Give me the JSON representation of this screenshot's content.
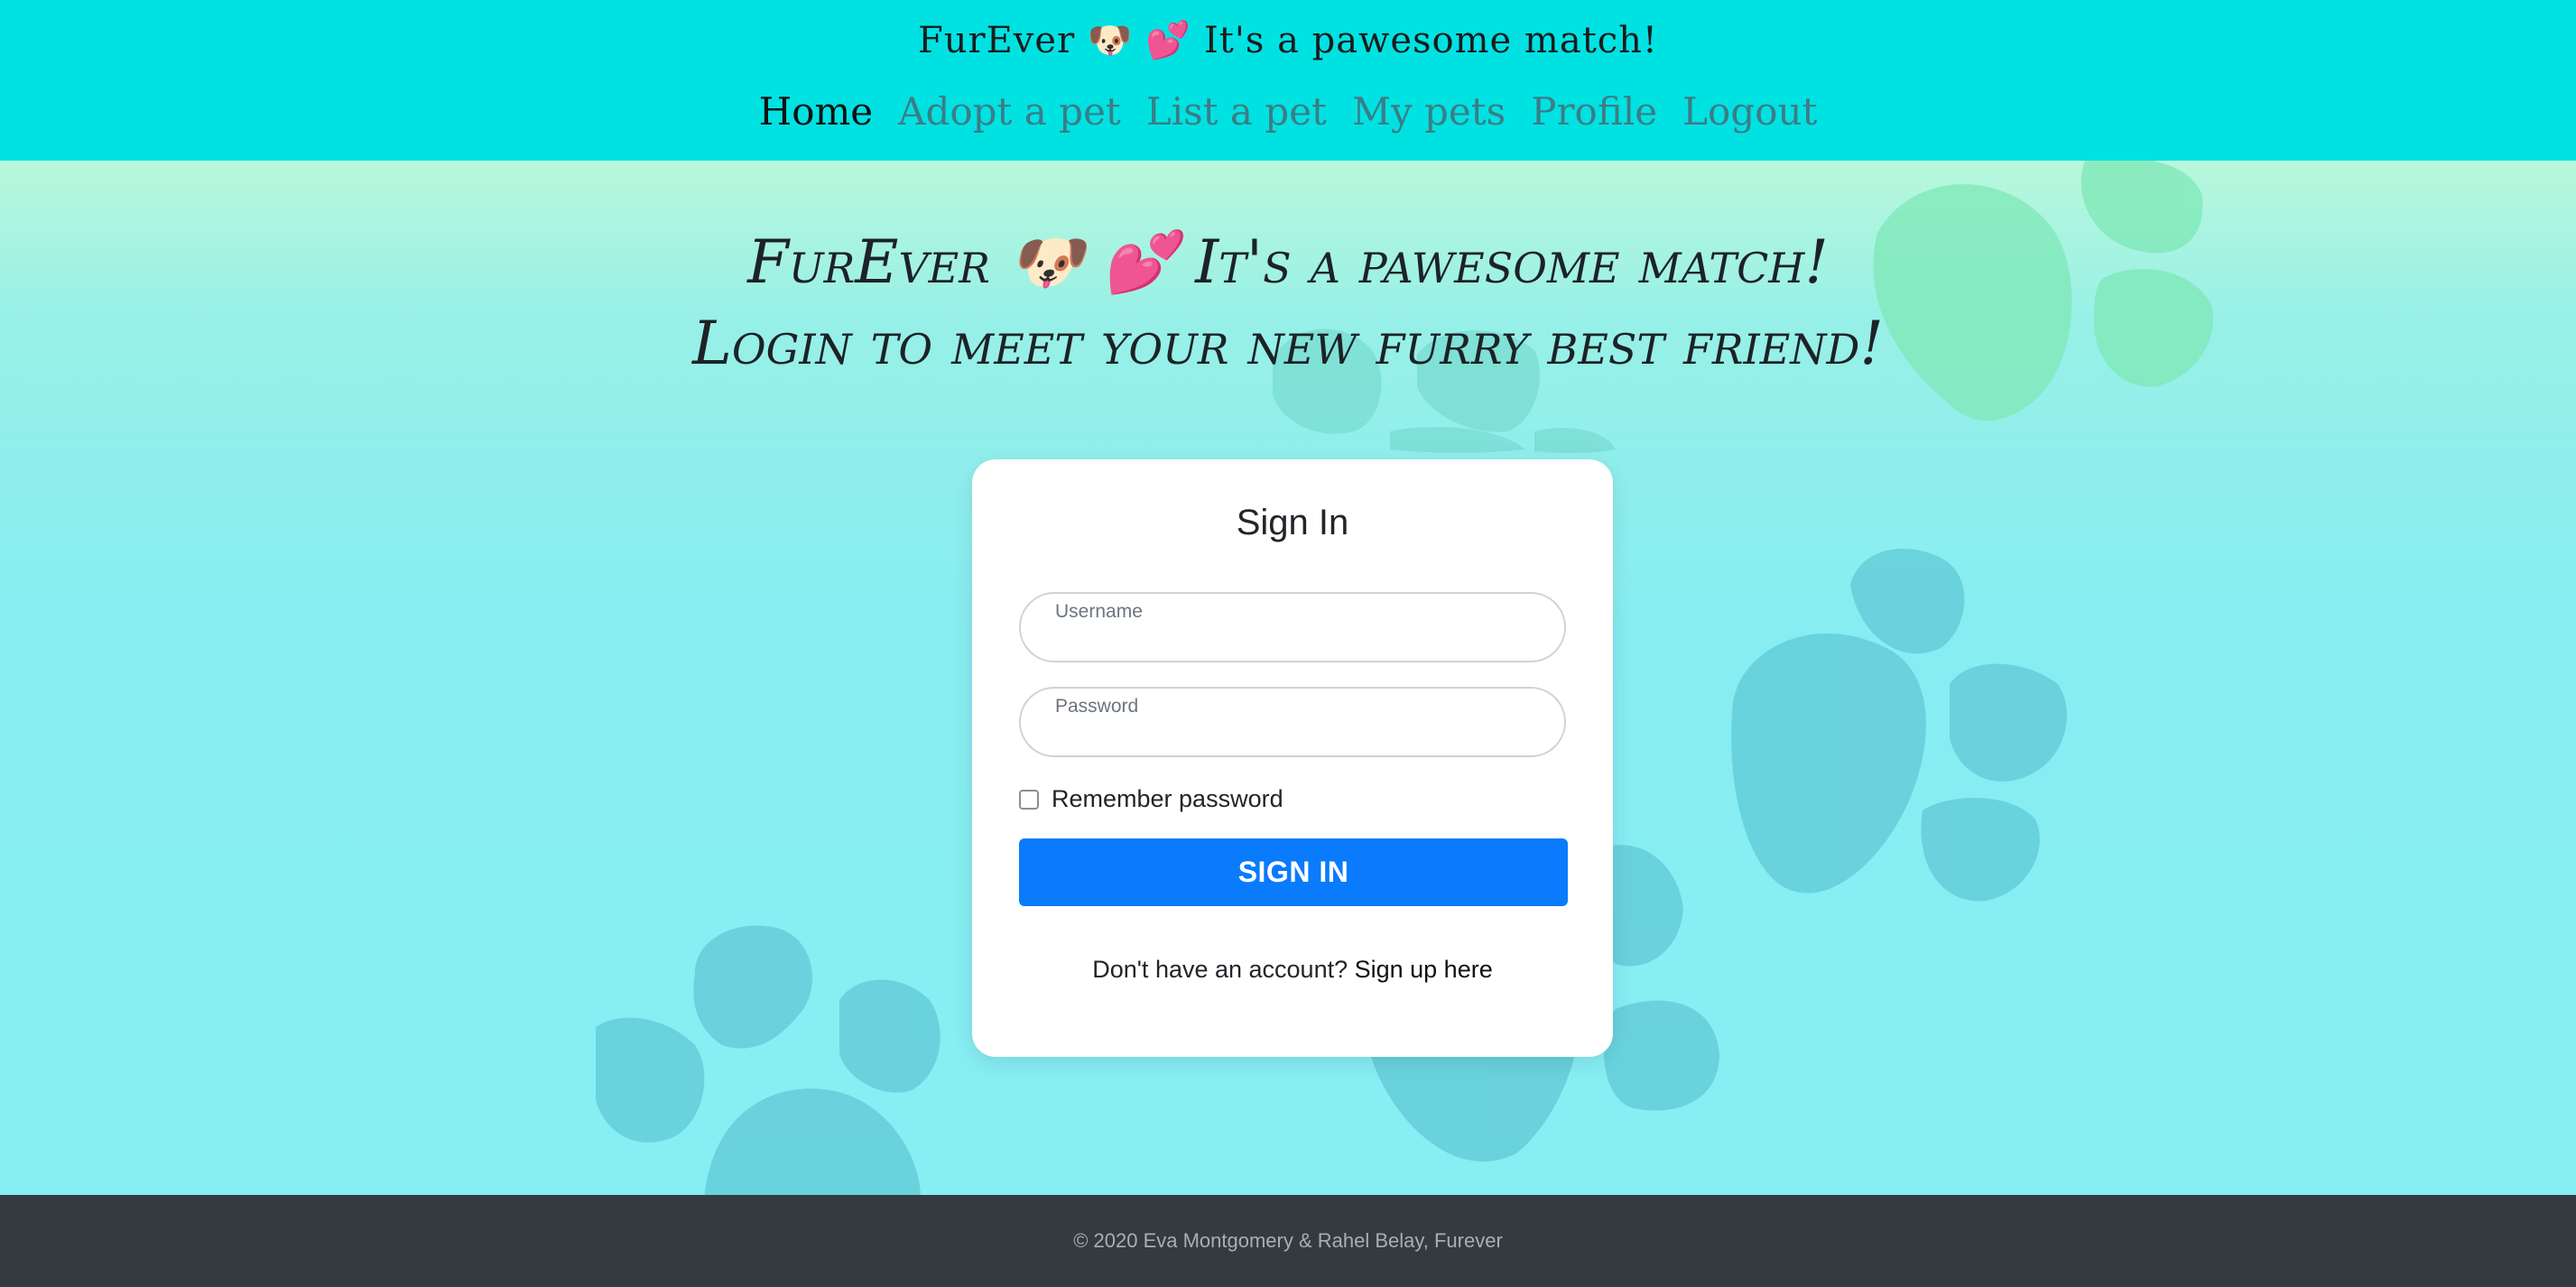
{
  "header": {
    "brand": "FurEver 🐶 💕 It's a pawesome match!",
    "nav": [
      {
        "label": "Home"
      },
      {
        "label": "Adopt a pet"
      },
      {
        "label": "List a pet"
      },
      {
        "label": "My pets"
      },
      {
        "label": "Profile"
      },
      {
        "label": "Logout"
      }
    ]
  },
  "hero": {
    "line1": "FurEver 🐶 💕 It's a pawesome match!",
    "line2": "Login to meet your new furry best friend!"
  },
  "signin": {
    "title": "Sign In",
    "username_label": "Username",
    "username_value": "",
    "password_label": "Password",
    "password_value": "",
    "remember_label": "Remember password",
    "remember_checked": false,
    "button_label": "SIGN IN",
    "signup_prompt": "Don't have an account?",
    "signup_link": "Sign up here"
  },
  "footer": {
    "text": "© 2020 Eva Montgomery & Rahel Belay, Furever"
  },
  "colors": {
    "header_bg": "#00e2e2",
    "button_bg": "#0a7bfc",
    "footer_bg": "#343a40",
    "paw_green": "#7ee8b5",
    "paw_teal": "#5fc9d6"
  },
  "icons": {
    "background": "paw-print-icon"
  }
}
